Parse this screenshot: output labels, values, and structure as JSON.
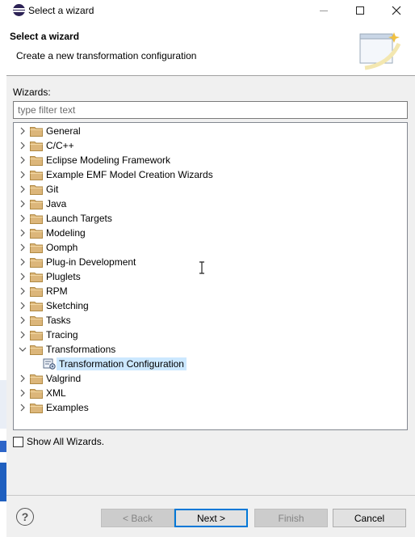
{
  "window": {
    "title": "Select a wizard",
    "controls": [
      "minimize-icon",
      "maximize-icon",
      "close-icon"
    ]
  },
  "header": {
    "title": "Select a wizard",
    "description": "Create a new transformation configuration",
    "icon": "wizard-banner-icon"
  },
  "wizards_label": "Wizards:",
  "filter": {
    "placeholder": "type filter text",
    "value": ""
  },
  "tree": [
    {
      "label": "General",
      "expanded": false
    },
    {
      "label": "C/C++",
      "expanded": false
    },
    {
      "label": "Eclipse Modeling Framework",
      "expanded": false
    },
    {
      "label": "Example EMF Model Creation Wizards",
      "expanded": false
    },
    {
      "label": "Git",
      "expanded": false
    },
    {
      "label": "Java",
      "expanded": false
    },
    {
      "label": "Launch Targets",
      "expanded": false
    },
    {
      "label": "Modeling",
      "expanded": false
    },
    {
      "label": "Oomph",
      "expanded": false
    },
    {
      "label": "Plug-in Development",
      "expanded": false
    },
    {
      "label": "Pluglets",
      "expanded": false
    },
    {
      "label": "RPM",
      "expanded": false
    },
    {
      "label": "Sketching",
      "expanded": false
    },
    {
      "label": "Tasks",
      "expanded": false
    },
    {
      "label": "Tracing",
      "expanded": false
    },
    {
      "label": "Transformations",
      "expanded": true,
      "children": [
        {
          "label": "Transformation Configuration",
          "selected": true
        }
      ]
    },
    {
      "label": "Valgrind",
      "expanded": false
    },
    {
      "label": "XML",
      "expanded": false
    },
    {
      "label": "Examples",
      "expanded": false
    }
  ],
  "show_all": {
    "label": "Show All Wizards.",
    "checked": false
  },
  "buttons": {
    "back": "< Back",
    "next": "Next >",
    "finish": "Finish",
    "cancel": "Cancel"
  },
  "colors": {
    "selection": "#cce8ff",
    "folder": "#dcb67a",
    "default_button_border": "#0078d7"
  }
}
